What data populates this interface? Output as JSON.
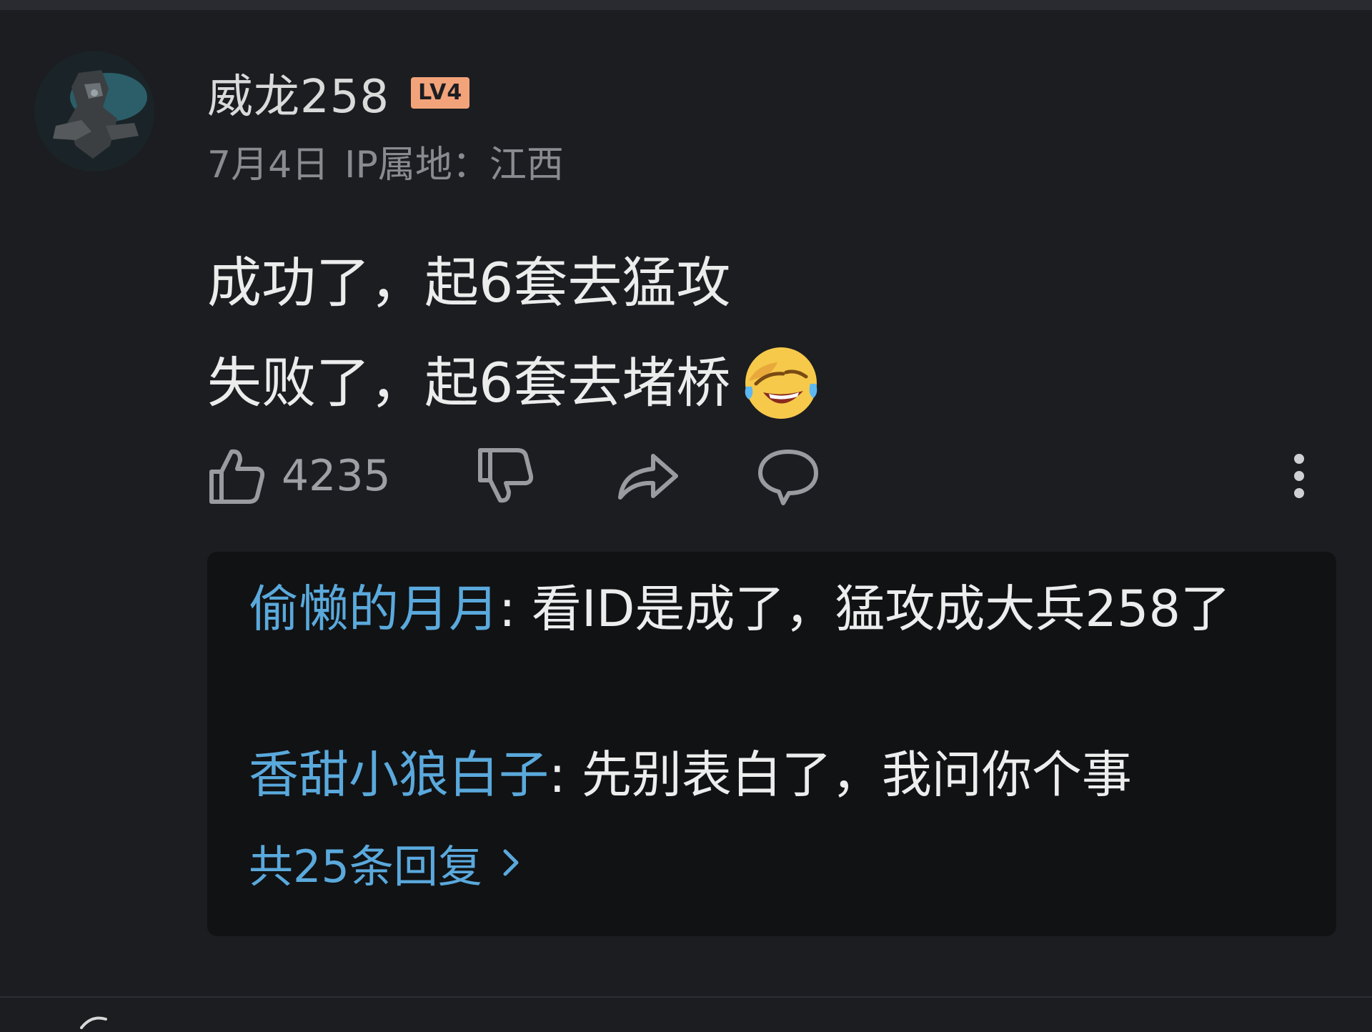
{
  "comment": {
    "username": "威龙258",
    "level_badge": "LV4",
    "date": "7月4日",
    "ip_location": "IP属地：江西",
    "lines": [
      "成功了，起6套去猛攻",
      "失败了，起6套去堵桥"
    ],
    "emoji": "laughing-crying-emoji",
    "like_count": "4235"
  },
  "replies": [
    {
      "author": "偷懒的月月",
      "separator": ": ",
      "text": "看ID是成了，猛攻成大兵258了"
    },
    {
      "author": "香甜小狼白子",
      "separator": ": ",
      "text": "先别表白了，我问你个事"
    }
  ],
  "more_replies": "共25条回复",
  "colors": {
    "background": "#1c1d21",
    "reply_panel": "#111214",
    "link_blue": "#5aa9dc",
    "badge_orange": "#f3a37a",
    "muted_text": "#8a8b90"
  },
  "icons": [
    "thumbs-up-icon",
    "thumbs-down-icon",
    "share-icon",
    "comment-icon",
    "more-icon",
    "chevron-right-icon"
  ]
}
